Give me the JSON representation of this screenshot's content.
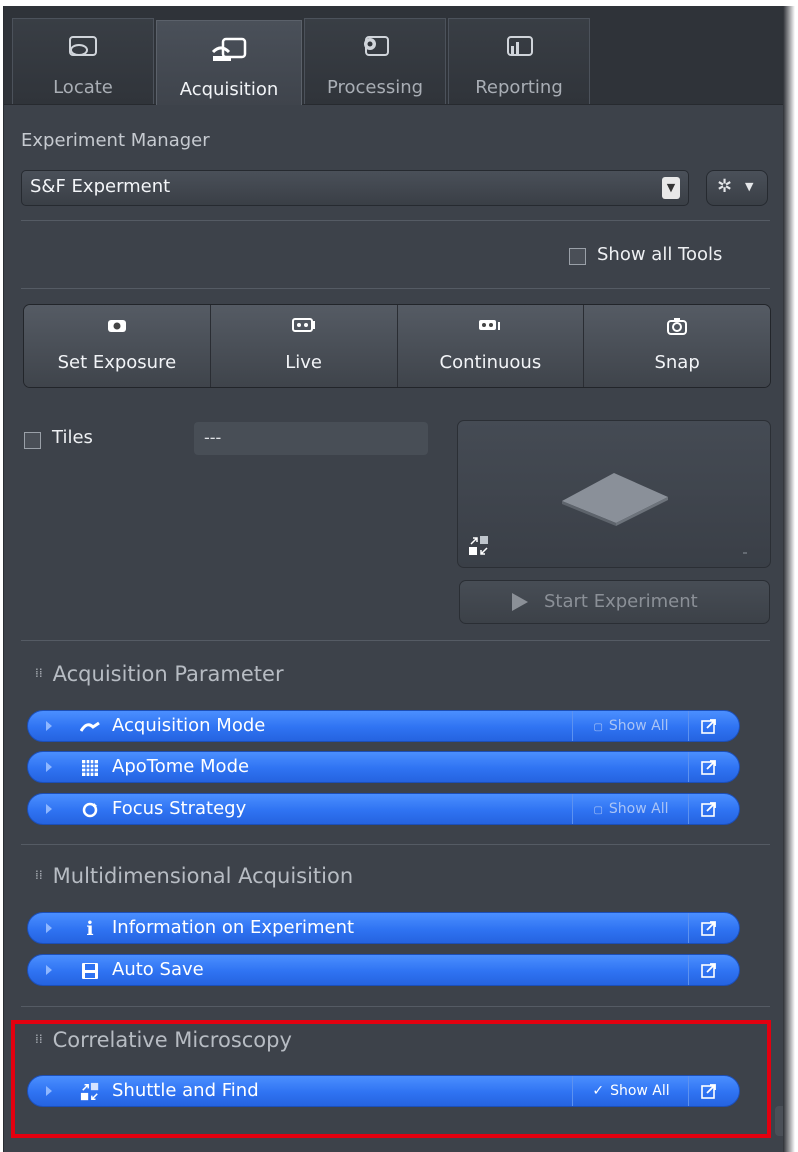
{
  "tabs": [
    {
      "label": "Locate",
      "icon": "locate-icon",
      "active": false
    },
    {
      "label": "Acquisition",
      "icon": "acquisition-icon",
      "active": true
    },
    {
      "label": "Processing",
      "icon": "processing-icon",
      "active": false
    },
    {
      "label": "Reporting",
      "icon": "reporting-icon",
      "active": false
    }
  ],
  "experiment_manager": {
    "label": "Experiment Manager",
    "selected": "S&F Experment",
    "settings_icon": "gear-icon"
  },
  "show_all_tools": {
    "label": "Show all Tools",
    "checked": false
  },
  "capture_buttons": [
    {
      "label": "Set Exposure",
      "icon": "camera-icon"
    },
    {
      "label": "Live",
      "icon": "live-icon"
    },
    {
      "label": "Continuous",
      "icon": "continuous-icon"
    },
    {
      "label": "Snap",
      "icon": "snap-icon"
    }
  ],
  "tiles": {
    "label": "Tiles",
    "checked": false,
    "value": "---"
  },
  "preview": {
    "icon": "shuttle-find-icon"
  },
  "start_experiment": {
    "label": "Start Experiment",
    "enabled": false
  },
  "sections": {
    "acquisition_parameter": {
      "title": "Acquisition Parameter",
      "tools": [
        {
          "label": "Acquisition Mode",
          "icon": "acquisition-mode-icon",
          "show_all": "Show All",
          "show_all_checked": false
        },
        {
          "label": "ApoTome Mode",
          "icon": "apotome-grid-icon",
          "show_all": null
        },
        {
          "label": "Focus Strategy",
          "icon": "focus-strategy-icon",
          "show_all": "Show All",
          "show_all_checked": false
        }
      ]
    },
    "multidimensional_acquisition": {
      "title": "Multidimensional Acquisition",
      "tools": [
        {
          "label": "Information on Experiment",
          "icon": "info-icon",
          "glyph": "i"
        },
        {
          "label": "Auto Save",
          "icon": "save-icon"
        }
      ]
    },
    "correlative_microscopy": {
      "title": "Correlative Microscopy",
      "tools": [
        {
          "label": "Shuttle and Find",
          "icon": "shuttle-find-icon",
          "show_all": "Show All",
          "show_all_checked": true
        }
      ]
    }
  },
  "colors": {
    "panel_bg": "#3d424a",
    "tool_blue": "#2f73f2",
    "highlight_red": "#e3000f"
  }
}
